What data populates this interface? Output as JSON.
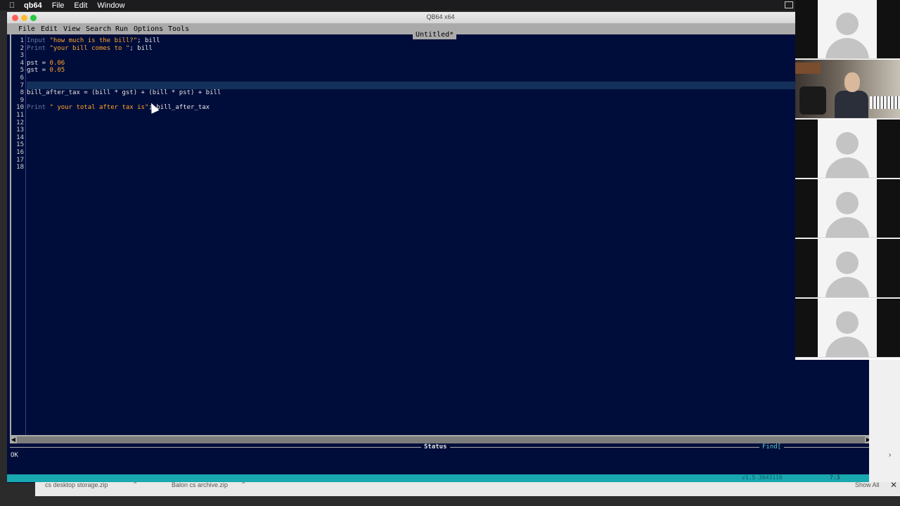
{
  "mac_menu": {
    "app": "qb64",
    "items": [
      "File",
      "Edit",
      "Window"
    ]
  },
  "window": {
    "title": "QB64 x64",
    "file_tab": "Untitled*"
  },
  "menu": {
    "items": [
      "File",
      "Edit",
      "View",
      "Search",
      "Run",
      "Options",
      "Tools"
    ]
  },
  "editor": {
    "line_numbers": [
      "1",
      "2",
      "3",
      "4",
      "5",
      "6",
      "7",
      "8",
      "9",
      "10",
      "11",
      "12",
      "13",
      "14",
      "15",
      "16",
      "17",
      "18"
    ],
    "lines": [
      {
        "kw": "Input",
        "str": " \"how much is the bill?\"",
        "rest": "; bill"
      },
      {
        "kw": "Print",
        "str": " \"your bill comes to \"",
        "rest": "; bill"
      },
      {
        "kw": "",
        "str": "",
        "rest": ""
      },
      {
        "kw": "",
        "str": "",
        "rest": "pst = ",
        "num": "0.06"
      },
      {
        "kw": "",
        "str": "",
        "rest": "gst = ",
        "num": "0.05"
      },
      {
        "kw": "",
        "str": "",
        "rest": ""
      },
      {
        "kw": "",
        "str": "",
        "rest": ""
      },
      {
        "kw": "",
        "str": "",
        "rest": "bill_after_tax = (bill * gst) + (bill * pst) + bill"
      },
      {
        "kw": "",
        "str": "",
        "rest": ""
      },
      {
        "kw": "Print",
        "str": " \" your total after tax is\"",
        "rest": "; bill_after_tax"
      }
    ]
  },
  "status": {
    "label": "Status",
    "find": "Find[",
    "text": "OK",
    "version": "v1.5 3043116",
    "cursor": "7:3"
  },
  "downloads": {
    "items": [
      "cs desktop storage.zip",
      "Balon cs archive.zip"
    ],
    "show_all": "Show All"
  },
  "colors": {
    "editor_bg": "#000d3a",
    "keyword": "#6a7ab0",
    "string": "#ffa52a",
    "statusbar": "#19a7b0"
  }
}
